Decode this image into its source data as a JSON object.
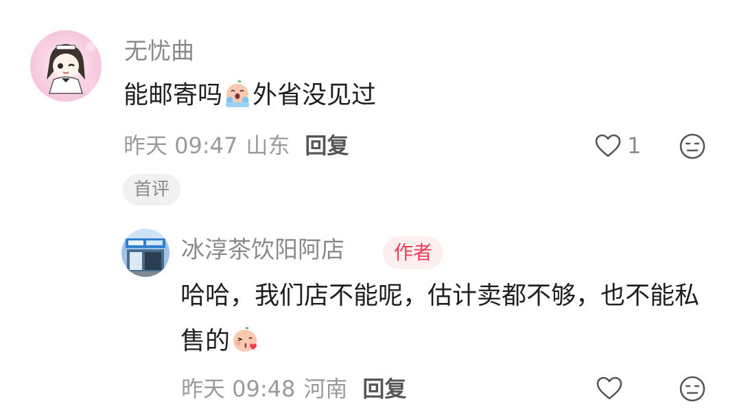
{
  "comment": {
    "username": "无忧曲",
    "text_before": "能邮寄吗",
    "emoji_1": "crying-emoji",
    "text_after": "外省没见过",
    "time": "昨天 09:47",
    "location": "山东",
    "reply_label": "回复",
    "like_count": "1",
    "badge": "首评"
  },
  "reply": {
    "username": "冰淳茶饮阳阿店",
    "author_badge": "作者",
    "text": "哈哈，我们店不能呢，估计卖都不够，也不能私售的",
    "emoji": "kiss-emoji",
    "time": "昨天 09:48",
    "location": "河南",
    "reply_label": "回复"
  },
  "colors": {
    "author_badge_text": "#ee3d57",
    "author_badge_bg": "#fdeef0",
    "meta_text": "#9a9a9a",
    "username_text": "#8a8a8a"
  }
}
